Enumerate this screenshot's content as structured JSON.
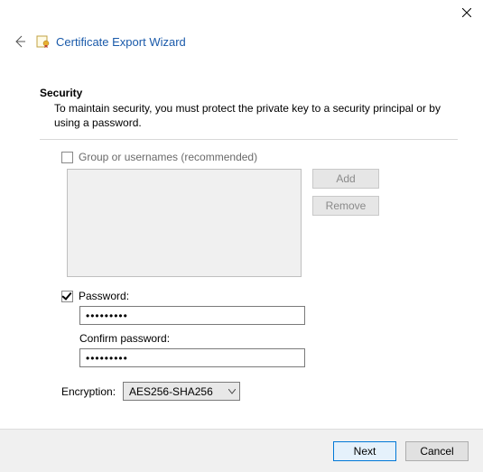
{
  "window": {
    "title": "Certificate Export Wizard"
  },
  "section": {
    "heading": "Security",
    "description": "To maintain security, you must protect the private key to a security principal or by using a password."
  },
  "group": {
    "checkbox_label": "Group or usernames (recommended)",
    "checked": false,
    "add_label": "Add",
    "remove_label": "Remove"
  },
  "password": {
    "checkbox_label": "Password:",
    "checked": true,
    "value": "•••••••••",
    "confirm_label": "Confirm password:",
    "confirm_value": "•••••••••"
  },
  "encryption": {
    "label": "Encryption:",
    "selected": "AES256-SHA256"
  },
  "footer": {
    "next_label": "Next",
    "cancel_label": "Cancel"
  }
}
